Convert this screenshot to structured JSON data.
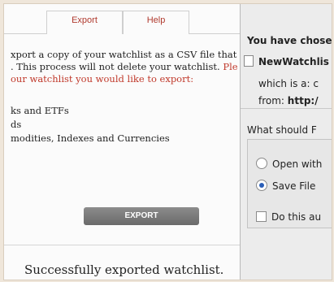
{
  "tabs": {
    "export": "Export",
    "help": "Help"
  },
  "description": {
    "line1": "xport a copy of your watchlist as a CSV file that c",
    "line2a": ". This process will not delete your watchlist. ",
    "line2b": "Ple",
    "line3": "our watchlist you would like to export:"
  },
  "options": [
    "ks and ETFs",
    "ds",
    "modities, Indexes and Currencies"
  ],
  "export_button": "EXPORT",
  "success_message": "Successfully exported watchlist.",
  "dialog": {
    "title": "You have chose",
    "file_name": "NewWatchlis",
    "which_is": "which is a:  c",
    "from_label": "from:",
    "from_value": "http:/",
    "question": "What should F",
    "open_with": "Open with",
    "save_file": "Save File",
    "do_this": "Do this au"
  }
}
